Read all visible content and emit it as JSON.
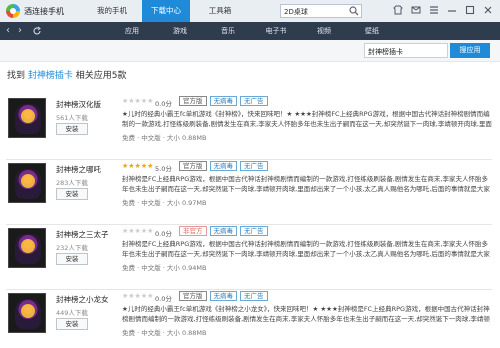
{
  "app": {
    "title": "酒连接手机"
  },
  "top_nav": [
    {
      "label": "我的手机",
      "active": false
    },
    {
      "label": "下载中心",
      "active": true
    },
    {
      "label": "工具箱",
      "active": false
    }
  ],
  "top_search": {
    "value": "2D桌球"
  },
  "categories": [
    "应用",
    "游戏",
    "音乐",
    "电子书",
    "视频",
    "壁纸"
  ],
  "inner_search": {
    "value": "封神榜插卡",
    "button": "搜应用"
  },
  "result_heading": {
    "prefix": "找到",
    "keyword": "封神榜插卡",
    "suffix": "相关应用5款"
  },
  "results": [
    {
      "name": "封神榜汉化版",
      "size": "561人下载",
      "install": "安装",
      "rating": 0,
      "score": "0.0分",
      "badges": [
        {
          "type": "official",
          "label": "官方版"
        },
        {
          "type": "safe",
          "label": "无病毒"
        },
        {
          "type": "noad",
          "label": "无广告"
        }
      ],
      "desc": "★儿时的经典小霸王fc单机游戏《封神榜》，快来回味吧！★ ★★★封神榜FC上经典RPG游戏，根据中国古代神话封神榜剧情而编制的一款游戏,打怪练级刷装备,剧情发生在商末,李家夫人怀胎多年也未生出子嗣而在这一天,却突然诞下一肉球,李靖顿开肉球,里面却出来了一个小孩,太乙真人赐他名为哪吒,后面的事情就是大家熟知的哪吒闹海",
      "meta": "免费 · 中文版 · 大小 0.88MB"
    },
    {
      "name": "封神榜之哪吒",
      "size": "283人下载",
      "install": "安装",
      "rating": 5,
      "score": "5.0分",
      "badges": [
        {
          "type": "official",
          "label": "官方版"
        },
        {
          "type": "safe",
          "label": "无病毒"
        },
        {
          "type": "noad",
          "label": "无广告"
        }
      ],
      "desc": "封神榜是FC上经典RPG游戏，根据中国古代神话封神榜剧情而编制的一款游戏,打怪练级刷装备,剧情发生在商末,李家夫人怀胎多年也未生出子嗣而在这一天,却突然诞下一肉球,李靖顿开肉球,里面却出来了一个小孩,太乙真人赐他名为哪吒,后面的事情就是大家熟知的哪吒闹海",
      "meta": "免费 · 中文版 · 大小 0.97MB"
    },
    {
      "name": "封神榜之三太子",
      "size": "232人下载",
      "install": "安装",
      "rating": 0,
      "score": "0.0分",
      "badges": [
        {
          "type": "nonofficial",
          "label": "非官方"
        },
        {
          "type": "safe",
          "label": "无病毒"
        },
        {
          "type": "noad",
          "label": "无广告"
        }
      ],
      "desc": "封神榜是FC上经典RPG游戏，根据中国古代神话封神榜剧情而编制的一款游戏,打怪练级刷装备,剧情发生在商末,李家夫人怀胎多年也未生出子嗣而在这一天,却突然诞下一肉球,李靖顿开肉球,里面却出来了一个小孩,太乙真人赐他名为哪吒,后面的事情就是大家熟知的哪吒闹海",
      "meta": "免费 · 中文版 · 大小 0.94MB"
    },
    {
      "name": "封神榜之小龙女",
      "size": "449人下载",
      "install": "安装",
      "rating": 0,
      "score": "0.0分",
      "badges": [
        {
          "type": "official",
          "label": "官方版"
        },
        {
          "type": "safe",
          "label": "无病毒"
        },
        {
          "type": "noad",
          "label": "无广告"
        }
      ],
      "desc": "★儿时的经典小霸王fc单机游戏《封神榜之小龙女》，快来回味吧！★ ★★★封神榜是FC上经典RPG游戏，根据中国古代神话封神榜剧情而编制的一款游戏,打怪练级刷装备,剧情发生在商末,李家夫人怀胎多年也未生出子嗣而在这一天,却突然诞下一肉球,李靖顿开肉球,里面却出来了一个小孩,太乙真人赐他名为哪吒,后面的事情就是大家熟知的哪吒闹海",
      "meta": "免费 · 中文版 · 大小 0.88MB"
    }
  ]
}
